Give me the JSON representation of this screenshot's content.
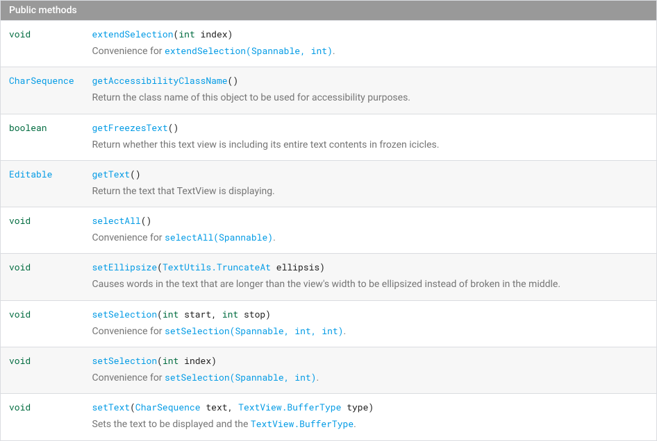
{
  "header": "Public methods",
  "methods": [
    {
      "ret": [
        {
          "t": "void",
          "cls": "kw"
        }
      ],
      "sig": [
        {
          "t": "extendSelection",
          "cls": "link"
        },
        {
          "t": "("
        },
        {
          "t": "int",
          "cls": "kw"
        },
        {
          "t": " index)"
        }
      ],
      "desc": [
        {
          "t": "Convenience for "
        },
        {
          "t": "extendSelection(Spannable, int)",
          "cls": "link mono"
        },
        {
          "t": "."
        }
      ]
    },
    {
      "ret": [
        {
          "t": "CharSequence",
          "cls": "link"
        }
      ],
      "sig": [
        {
          "t": "getAccessibilityClassName",
          "cls": "link"
        },
        {
          "t": "()"
        }
      ],
      "desc": [
        {
          "t": "Return the class name of this object to be used for accessibility purposes."
        }
      ]
    },
    {
      "ret": [
        {
          "t": "boolean",
          "cls": "kw"
        }
      ],
      "sig": [
        {
          "t": "getFreezesText",
          "cls": "link"
        },
        {
          "t": "()"
        }
      ],
      "desc": [
        {
          "t": "Return whether this text view is including its entire text contents in frozen icicles."
        }
      ]
    },
    {
      "ret": [
        {
          "t": "Editable",
          "cls": "link"
        }
      ],
      "sig": [
        {
          "t": "getText",
          "cls": "link"
        },
        {
          "t": "()"
        }
      ],
      "desc": [
        {
          "t": "Return the text that TextView is displaying."
        }
      ]
    },
    {
      "ret": [
        {
          "t": "void",
          "cls": "kw"
        }
      ],
      "sig": [
        {
          "t": "selectAll",
          "cls": "link"
        },
        {
          "t": "()"
        }
      ],
      "desc": [
        {
          "t": "Convenience for "
        },
        {
          "t": "selectAll(Spannable)",
          "cls": "link mono"
        },
        {
          "t": "."
        }
      ]
    },
    {
      "ret": [
        {
          "t": "void",
          "cls": "kw"
        }
      ],
      "sig": [
        {
          "t": "setEllipsize",
          "cls": "link"
        },
        {
          "t": "("
        },
        {
          "t": "TextUtils.TruncateAt",
          "cls": "link"
        },
        {
          "t": " ellipsis)"
        }
      ],
      "desc": [
        {
          "t": "Causes words in the text that are longer than the view's width to be ellipsized instead of broken in the middle."
        }
      ]
    },
    {
      "ret": [
        {
          "t": "void",
          "cls": "kw"
        }
      ],
      "sig": [
        {
          "t": "setSelection",
          "cls": "link"
        },
        {
          "t": "("
        },
        {
          "t": "int",
          "cls": "kw"
        },
        {
          "t": " start, "
        },
        {
          "t": "int",
          "cls": "kw"
        },
        {
          "t": " stop)"
        }
      ],
      "desc": [
        {
          "t": "Convenience for "
        },
        {
          "t": "setSelection(Spannable, int, int)",
          "cls": "link mono"
        },
        {
          "t": "."
        }
      ]
    },
    {
      "ret": [
        {
          "t": "void",
          "cls": "kw"
        }
      ],
      "sig": [
        {
          "t": "setSelection",
          "cls": "link"
        },
        {
          "t": "("
        },
        {
          "t": "int",
          "cls": "kw"
        },
        {
          "t": " index)"
        }
      ],
      "desc": [
        {
          "t": "Convenience for "
        },
        {
          "t": "setSelection(Spannable, int)",
          "cls": "link mono"
        },
        {
          "t": "."
        }
      ]
    },
    {
      "ret": [
        {
          "t": "void",
          "cls": "kw"
        }
      ],
      "sig": [
        {
          "t": "setText",
          "cls": "link"
        },
        {
          "t": "("
        },
        {
          "t": "CharSequence",
          "cls": "link"
        },
        {
          "t": " text, "
        },
        {
          "t": "TextView.BufferType",
          "cls": "link"
        },
        {
          "t": " type)"
        }
      ],
      "desc": [
        {
          "t": "Sets the text to be displayed and the "
        },
        {
          "t": "TextView.BufferType",
          "cls": "link mono"
        },
        {
          "t": "."
        }
      ]
    }
  ]
}
